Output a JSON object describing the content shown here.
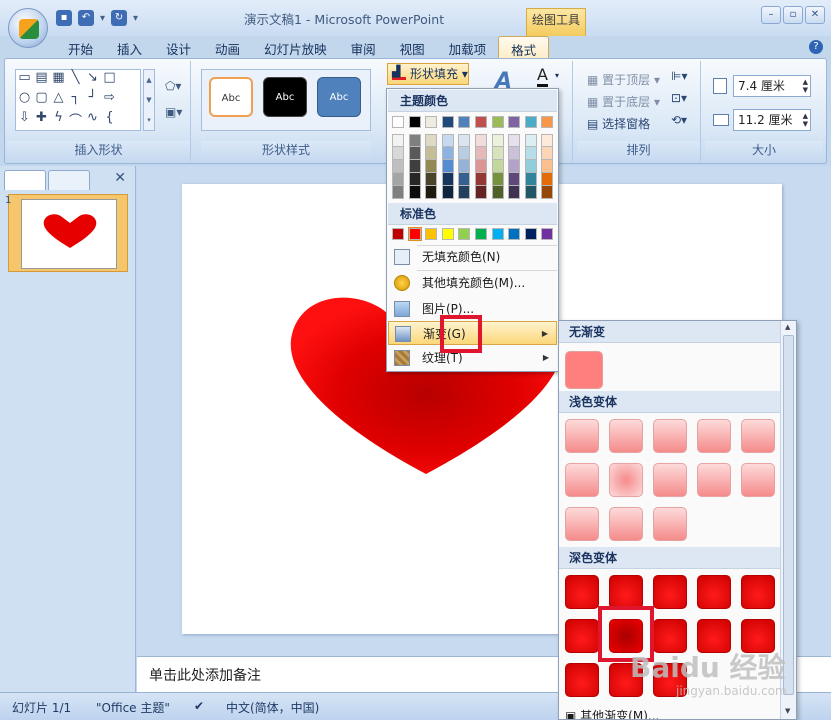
{
  "window": {
    "title": "演示文稿1 - Microsoft PowerPoint",
    "context_tab": "绘图工具"
  },
  "tabs": [
    "开始",
    "插入",
    "设计",
    "动画",
    "幻灯片放映",
    "审阅",
    "视图",
    "加载项",
    "格式"
  ],
  "ribbon": {
    "groups": [
      "插入形状",
      "形状样式",
      "排列",
      "大小"
    ],
    "style_samples": [
      "Abc",
      "Abc",
      "Abc"
    ],
    "fill_button": "形状填充",
    "arrange": [
      "置于顶层",
      "置于底层",
      "选择窗格"
    ],
    "size": {
      "height": "7.4 厘米",
      "width": "11.2 厘米"
    }
  },
  "fill_menu": {
    "theme_colors": "主题颜色",
    "standard_colors": "标准色",
    "no_fill": "无填充颜色(N)",
    "more_colors": "其他填充颜色(M)...",
    "picture": "图片(P)...",
    "gradient": "渐变(G)",
    "texture": "纹理(T)",
    "theme_top": [
      "#ffffff",
      "#000000",
      "#eeece1",
      "#1f497d",
      "#4f81bd",
      "#c0504d",
      "#9bbb59",
      "#8064a2",
      "#4bacc6",
      "#f79646"
    ],
    "theme_shades": [
      [
        "#f2f2f2",
        "#7f7f7f",
        "#ddd9c3",
        "#c6d9f0",
        "#dbe5f1",
        "#f2dcdb",
        "#ebf1dd",
        "#e5e0ec",
        "#dbeef3",
        "#fdeada"
      ],
      [
        "#d8d8d8",
        "#595959",
        "#c4bd97",
        "#8db3e2",
        "#b8cce4",
        "#e5b9b7",
        "#d7e3bc",
        "#ccc1d9",
        "#b7dde8",
        "#fbd5b5"
      ],
      [
        "#bfbfbf",
        "#3f3f3f",
        "#938953",
        "#548dd4",
        "#95b3d7",
        "#d99694",
        "#c3d69b",
        "#b2a2c7",
        "#92cddc",
        "#fac08f"
      ],
      [
        "#a5a5a5",
        "#262626",
        "#494429",
        "#17365d",
        "#366092",
        "#953734",
        "#76923c",
        "#5f497a",
        "#31859b",
        "#e36c09"
      ],
      [
        "#7f7f7f",
        "#0c0c0c",
        "#1d1b10",
        "#0f243e",
        "#244061",
        "#632423",
        "#4f6128",
        "#3f3151",
        "#205867",
        "#974806"
      ]
    ],
    "standard": [
      "#c00000",
      "#ff0000",
      "#ffc000",
      "#ffff00",
      "#92d050",
      "#00b050",
      "#00b0f0",
      "#0070c0",
      "#002060",
      "#7030a0"
    ]
  },
  "gradient_menu": {
    "none": "无渐变",
    "light": "浅色变体",
    "dark": "深色变体",
    "more": "其他渐变(M)..."
  },
  "slides_panel": {
    "slide_number": "1"
  },
  "notes": "单击此处添加备注",
  "status": {
    "slide": "幻灯片 1/1",
    "theme": "\"Office 主题\"",
    "language": "中文(简体，中国)"
  },
  "watermark": {
    "brand": "Baidu 经验",
    "url": "jingyan.baidu.com"
  },
  "heart_color": "#e60000"
}
